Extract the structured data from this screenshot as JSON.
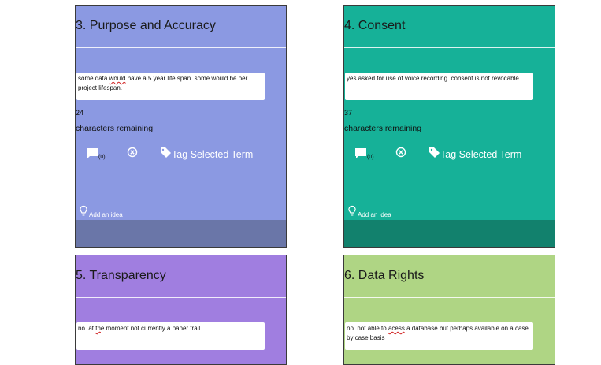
{
  "colors": {
    "card1_bg": "#8b99e2",
    "card1_footer": "#6a76a8",
    "card2_bg": "#16b198",
    "card2_footer": "#12816d",
    "card3_bg": "#a07ee0",
    "card4_bg": "#afd584"
  },
  "icons": {
    "comment": "comment-icon",
    "remove": "circle-x-icon",
    "tag": "tag-icon",
    "idea": "lightbulb-icon"
  },
  "cards": [
    {
      "title": "3. Purpose and Accuracy",
      "text_before": "some data ",
      "text_misspelled": "would",
      "text_after": " have a 5 year life span. some would be per project lifespan.",
      "count": "24",
      "remaining_label": "characters remaining",
      "comment_count": "(0)",
      "tag_label": "Tag Selected Term",
      "idea_label": "Add an idea"
    },
    {
      "title": "4. Consent",
      "text": "yes asked for use of voice recording. consent is not revocable.",
      "count": "37",
      "remaining_label": "characters remaining",
      "comment_count": "(0)",
      "tag_label": "Tag Selected Term",
      "idea_label": "Add an idea"
    },
    {
      "title": "5. Transparency",
      "text_before": "no. at ",
      "text_misspelled": "th",
      "text_after": "e moment not currently a paper trail"
    },
    {
      "title": "6. Data Rights",
      "text_before": "no. not able to ",
      "text_misspelled": "acess",
      "text_after": " a database but perhaps available on a case by case basis"
    }
  ]
}
